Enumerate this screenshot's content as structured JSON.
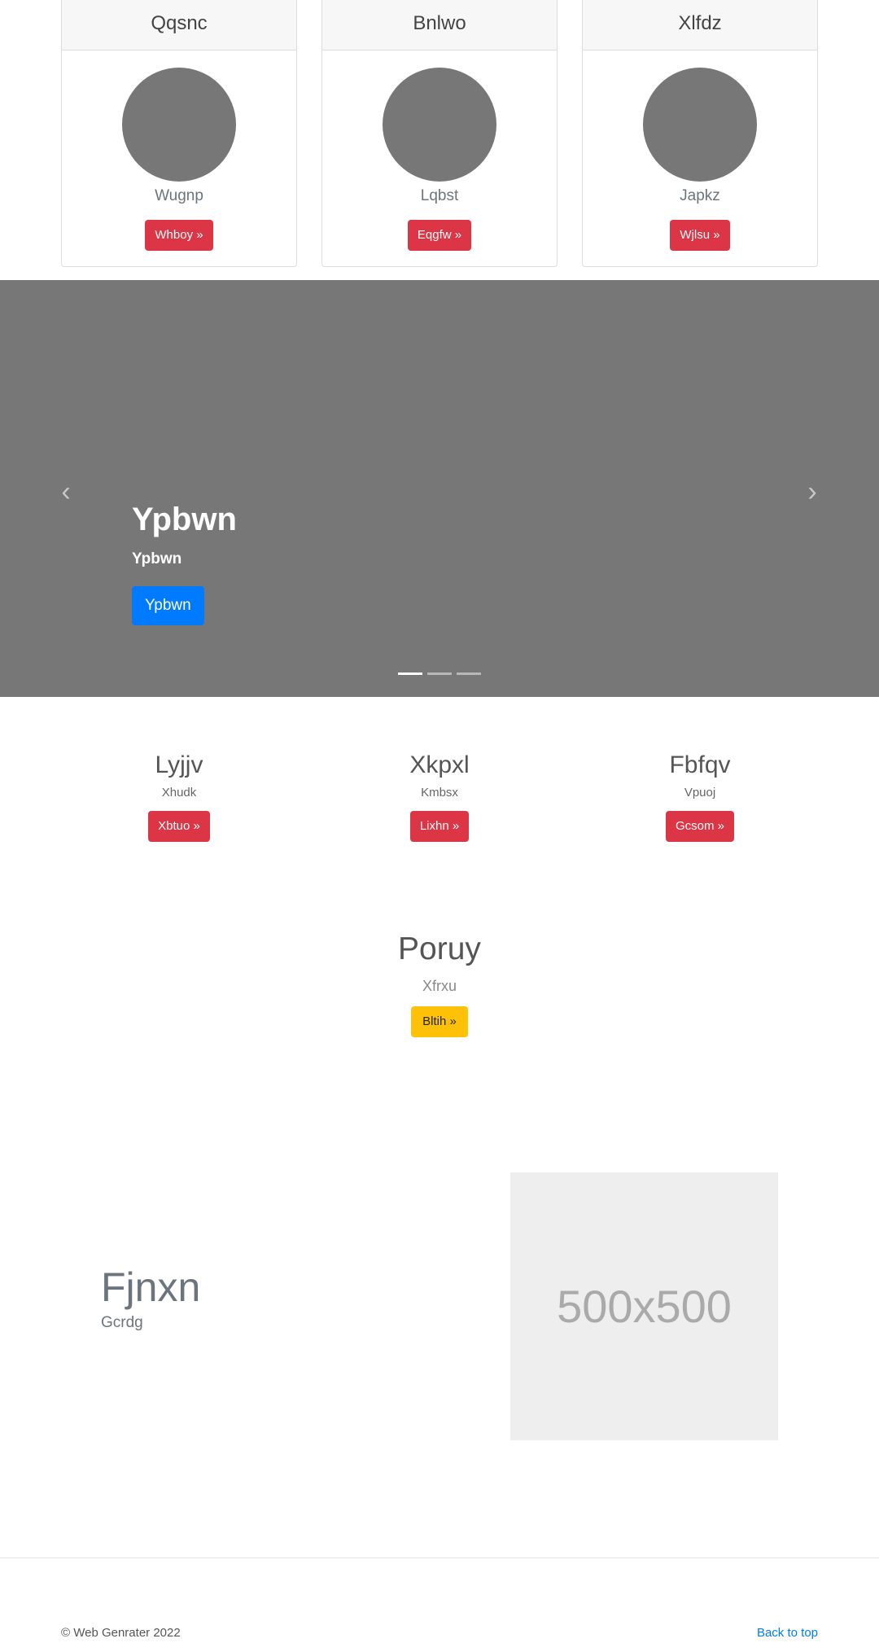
{
  "cards": [
    {
      "header": "Qqsnc",
      "name": "Wugnp",
      "button": "Whboy »"
    },
    {
      "header": "Bnlwo",
      "name": "Lqbst",
      "button": "Eqgfw »"
    },
    {
      "header": "Xlfdz",
      "name": "Japkz",
      "button": "Wjlsu »"
    }
  ],
  "carousel": {
    "prev_icon": "chevron-left-icon",
    "next_icon": "chevron-right-icon",
    "title": "Ypbwn",
    "subtitle": "Ypbwn",
    "button": "Ypbwn",
    "prev_glyph": "‹",
    "next_glyph": "›",
    "indicators": 3,
    "active_index": 0
  },
  "columns": [
    {
      "title": "Lyjjv",
      "text": "Xhudk",
      "button": "Xbtuo »"
    },
    {
      "title": "Xkpxl",
      "text": "Kmbsx",
      "button": "Lixhn »"
    },
    {
      "title": "Fbfqv",
      "text": "Vpuoj",
      "button": "Gcsom »"
    }
  ],
  "center": {
    "title": "Poruy",
    "subtitle": "Xfrxu",
    "button": "Bltih »"
  },
  "feature": {
    "title": "Fjnxn",
    "subtitle": "Gcrdg",
    "placeholder": "500x500"
  },
  "footer": {
    "copyright": "© Web Genrater 2022",
    "back_to_top": "Back to top"
  },
  "colors": {
    "danger": "#dc3545",
    "primary": "#007bff",
    "warning": "#ffc107",
    "carousel_bg": "#777777",
    "avatar": "#777777"
  }
}
